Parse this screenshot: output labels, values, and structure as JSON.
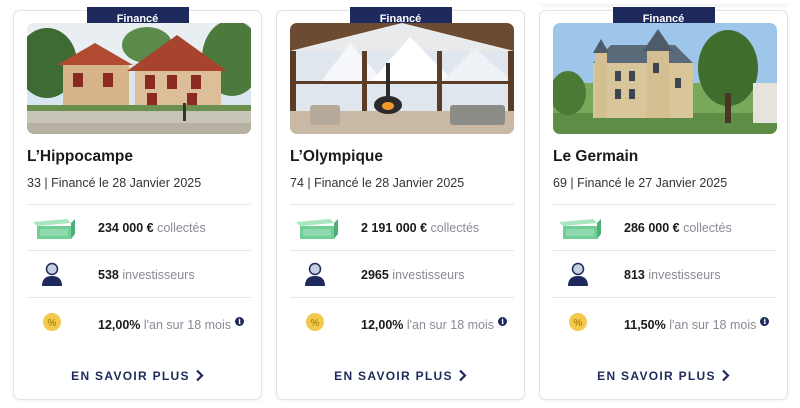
{
  "cards": [
    {
      "badge": "Financé",
      "title": "L’Hippocampe",
      "subtitle": "33 | Financé le 28 Janvier 2025",
      "amount": "234 000 €",
      "amount_label": "collectés",
      "investors": "538",
      "investors_label": "investisseurs",
      "rate": "12,00%",
      "rate_label": "l'an sur 18 mois",
      "cta": "EN SAVOIR PLUS",
      "image": "villa-house-photo"
    },
    {
      "badge": "Financé",
      "title": "L’Olympique",
      "subtitle": "74 | Financé le 28 Janvier 2025",
      "amount": "2 191 000 €",
      "amount_label": "collectés",
      "investors": "2965",
      "investors_label": "investisseurs",
      "rate": "12,00%",
      "rate_label": "l'an sur 18 mois",
      "cta": "EN SAVOIR PLUS",
      "image": "chalet-interior-photo"
    },
    {
      "badge": "Financé",
      "title": "Le Germain",
      "subtitle": "69 | Financé le 27 Janvier 2025",
      "amount": "286 000 €",
      "amount_label": "collectés",
      "investors": "813",
      "investors_label": "investisseurs",
      "rate": "11,50%",
      "rate_label": "l'an sur 18 mois",
      "cta": "EN SAVOIR PLUS",
      "image": "chateau-photo"
    }
  ],
  "icons": {
    "amount": "money-bills-icon",
    "investors": "investor-person-icon",
    "rate": "percent-coin-icon",
    "info": "info-icon",
    "cta": "chevron-right-icon"
  },
  "colors": {
    "navy": "#1d2a5b",
    "money_green": "#6fcf97",
    "coin_gold": "#f2c94c",
    "muted_text": "#8a8a96"
  }
}
